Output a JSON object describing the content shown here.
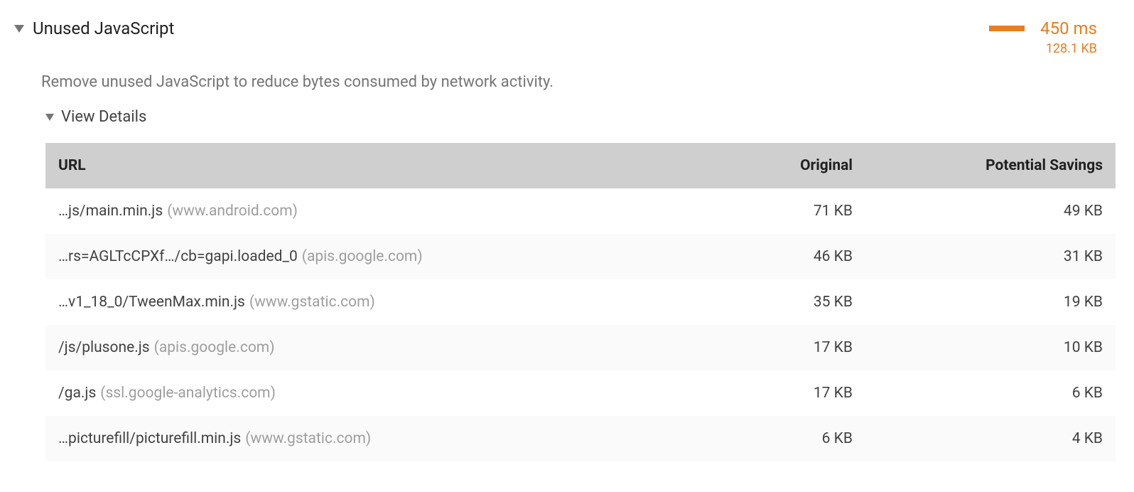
{
  "audit": {
    "title": "Unused JavaScript",
    "time": "450 ms",
    "size": "128.1 KB",
    "description": "Remove unused JavaScript to reduce bytes consumed by network activity.",
    "details_label": "View Details"
  },
  "table": {
    "headers": {
      "url": "URL",
      "original": "Original",
      "savings": "Potential Savings"
    },
    "rows": [
      {
        "path": "…js/main.min.js",
        "host": "(www.android.com)",
        "original": "71 KB",
        "savings": "49 KB"
      },
      {
        "path": "…rs=AGLTcCPXf…/cb=gapi.loaded_0",
        "host": "(apis.google.com)",
        "original": "46 KB",
        "savings": "31 KB"
      },
      {
        "path": "…v1_18_0/TweenMax.min.js",
        "host": "(www.gstatic.com)",
        "original": "35 KB",
        "savings": "19 KB"
      },
      {
        "path": "/js/plusone.js",
        "host": "(apis.google.com)",
        "original": "17 KB",
        "savings": "10 KB"
      },
      {
        "path": "/ga.js",
        "host": "(ssl.google-analytics.com)",
        "original": "17 KB",
        "savings": "6 KB"
      },
      {
        "path": "…picturefill/picturefill.min.js",
        "host": "(www.gstatic.com)",
        "original": "6 KB",
        "savings": "4 KB"
      }
    ]
  }
}
